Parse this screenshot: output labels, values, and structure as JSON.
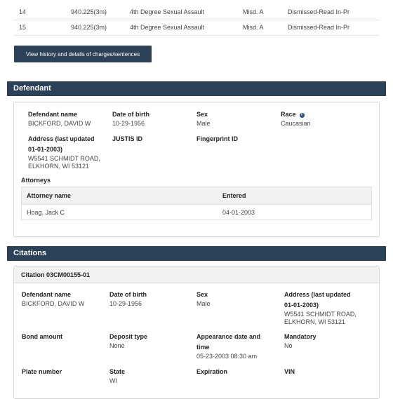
{
  "charges": {
    "rows": [
      {
        "count": "14",
        "statute": "940.225(3m)",
        "description": "4th Degree Sexual Assault",
        "severity": "Misd. A",
        "disposition": "Dismissed-Read In-Pr"
      },
      {
        "count": "15",
        "statute": "940.225(3m)",
        "description": "4th Degree Sexual Assault",
        "severity": "Misd. A",
        "disposition": "Dismissed-Read In-Pr"
      }
    ],
    "history_button": "View history and details of charges/sentences"
  },
  "defendant": {
    "section_title": "Defendant",
    "name_label": "Defendant name",
    "name": "BICKFORD, DAVID W",
    "dob_label": "Date of birth",
    "dob": "10-29-1956",
    "sex_label": "Sex",
    "sex": "Male",
    "race_label": "Race",
    "race": "Caucasian",
    "address_label_1": "Address (last updated",
    "address_label_2": "01-01-2003)",
    "address_line1": "W5541 SCHMIDT ROAD,",
    "address_line2": "ELKHORN, WI 53121",
    "justis_label": "JUSTIS ID",
    "fingerprint_label": "Fingerprint ID",
    "attorneys_label": "Attorneys",
    "attorneys_headers": {
      "name": "Attorney name",
      "entered": "Entered"
    },
    "attorneys": [
      {
        "name": "Hoag, Jack C",
        "entered": "04-01-2003"
      }
    ]
  },
  "citations": {
    "section_title": "Citations",
    "citation_title": "Citation 03CM00155-01",
    "name_label": "Defendant name",
    "name": "BICKFORD, DAVID W",
    "dob_label": "Date of birth",
    "dob": "10-29-1956",
    "sex_label": "Sex",
    "sex": "Male",
    "address_label_1": "Address (last updated",
    "address_label_2": "01-01-2003)",
    "address_line1": "W5541 SCHMIDT ROAD,",
    "address_line2": "ELKHORN, WI 53121",
    "bond_label": "Bond amount",
    "deposit_label": "Deposit type",
    "deposit": "None",
    "appearance_label_1": "Appearance date and",
    "appearance_label_2": "time",
    "appearance": "05-23-2003 08:30 am",
    "mandatory_label": "Mandatory",
    "mandatory": "No",
    "plate_label": "Plate number",
    "state_label": "State",
    "state": "WI",
    "expiration_label": "Expiration",
    "vin_label": "VIN"
  },
  "colors": {
    "header_bg": "#2b4157",
    "panel_border": "#d4d4d4",
    "info_icon": "#2b4f7a"
  }
}
